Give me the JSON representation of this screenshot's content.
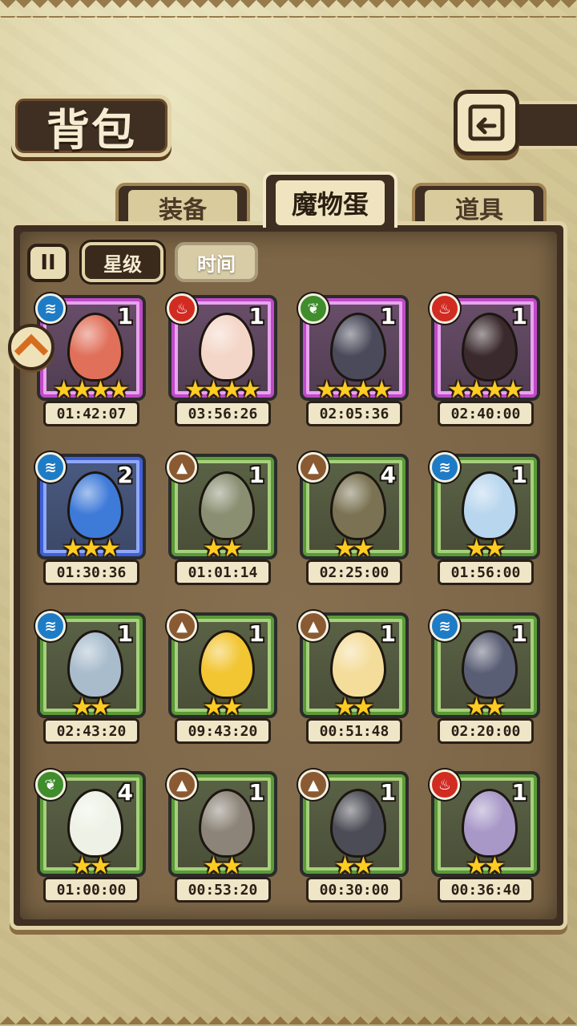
{
  "header": {
    "title": "背包"
  },
  "tabs": [
    {
      "label": "装备",
      "active": false
    },
    {
      "label": "魔物蛋",
      "active": true
    },
    {
      "label": "道具",
      "active": false
    }
  ],
  "sort": {
    "toggle_label": "II",
    "options": [
      {
        "label": "星级",
        "active": true
      },
      {
        "label": "时间",
        "active": false
      }
    ]
  },
  "colors": {
    "water": "#1e7bc6",
    "fire": "#d12b22",
    "earth": "#8a5a32",
    "wood": "#3f8d2c",
    "rarity_purple": "#c04ac8",
    "rarity_blue": "#3f5fd8",
    "rarity_green": "#5a9a38"
  },
  "eggs": [
    {
      "element": "water",
      "element_icon": "water-icon",
      "rarity": "purple",
      "count": "1",
      "stars": 4,
      "timer": "01:42:07",
      "egg_color": "#e0705a"
    },
    {
      "element": "fire",
      "element_icon": "fire-icon",
      "rarity": "purple",
      "count": "1",
      "stars": 4,
      "timer": "03:56:26",
      "egg_color": "#f4d6c8"
    },
    {
      "element": "wood",
      "element_icon": "leaf-icon",
      "rarity": "purple",
      "count": "1",
      "stars": 4,
      "timer": "02:05:36",
      "egg_color": "#4a4a5a"
    },
    {
      "element": "fire",
      "element_icon": "fire-icon",
      "rarity": "purple",
      "count": "1",
      "stars": 4,
      "timer": "02:40:00",
      "egg_color": "#3a2a2e"
    },
    {
      "element": "water",
      "element_icon": "water-icon",
      "rarity": "blue",
      "count": "2",
      "stars": 3,
      "timer": "01:30:36",
      "egg_color": "#3e7ad8"
    },
    {
      "element": "earth",
      "element_icon": "mountain-icon",
      "rarity": "green",
      "count": "1",
      "stars": 2,
      "timer": "01:01:14",
      "egg_color": "#8a8f72"
    },
    {
      "element": "earth",
      "element_icon": "mountain-icon",
      "rarity": "green",
      "count": "4",
      "stars": 2,
      "timer": "02:25:00",
      "egg_color": "#7a7252"
    },
    {
      "element": "water",
      "element_icon": "water-icon",
      "rarity": "green",
      "count": "1",
      "stars": 2,
      "timer": "01:56:00",
      "egg_color": "#b8d6ee"
    },
    {
      "element": "water",
      "element_icon": "water-icon",
      "rarity": "green",
      "count": "1",
      "stars": 2,
      "timer": "02:43:20",
      "egg_color": "#a8bccc"
    },
    {
      "element": "earth",
      "element_icon": "mountain-icon",
      "rarity": "green",
      "count": "1",
      "stars": 2,
      "timer": "09:43:20",
      "egg_color": "#f2c532"
    },
    {
      "element": "earth",
      "element_icon": "mountain-icon",
      "rarity": "green",
      "count": "1",
      "stars": 2,
      "timer": "00:51:48",
      "egg_color": "#f4dc9a"
    },
    {
      "element": "water",
      "element_icon": "water-icon",
      "rarity": "green",
      "count": "1",
      "stars": 2,
      "timer": "02:20:00",
      "egg_color": "#5a5e74"
    },
    {
      "element": "wood",
      "element_icon": "leaf-icon",
      "rarity": "green",
      "count": "4",
      "stars": 2,
      "timer": "01:00:00",
      "egg_color": "#eef2e6"
    },
    {
      "element": "earth",
      "element_icon": "mountain-icon",
      "rarity": "green",
      "count": "1",
      "stars": 2,
      "timer": "00:53:20",
      "egg_color": "#8c8478"
    },
    {
      "element": "earth",
      "element_icon": "mountain-icon",
      "rarity": "green",
      "count": "1",
      "stars": 2,
      "timer": "00:30:00",
      "egg_color": "#4c4c56"
    },
    {
      "element": "fire",
      "element_icon": "fire-icon",
      "rarity": "green",
      "count": "1",
      "stars": 2,
      "timer": "00:36:40",
      "egg_color": "#a898c8"
    }
  ]
}
